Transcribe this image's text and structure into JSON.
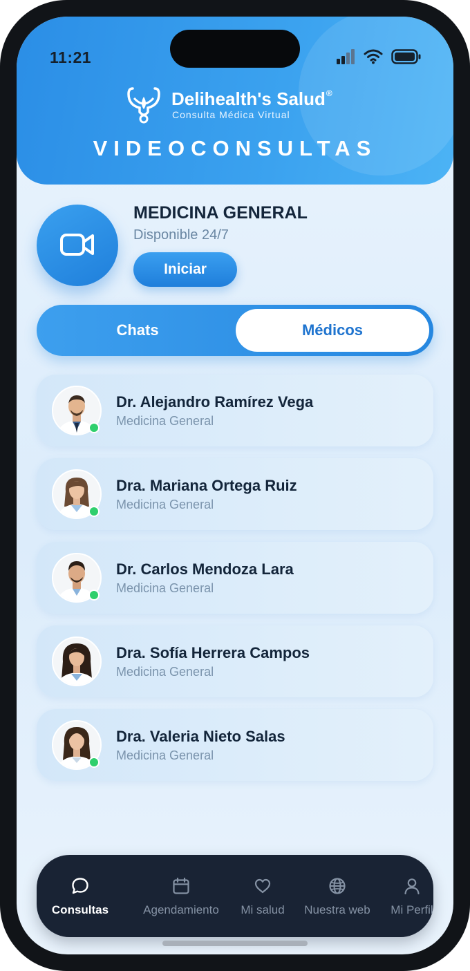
{
  "status_bar": {
    "time": "11:21"
  },
  "brand": {
    "name": "Delihealth's Salud",
    "registered": "®",
    "tagline": "Consulta Médica Virtual"
  },
  "header": {
    "title": "VIDEOCONSULTAS"
  },
  "service": {
    "title": "MEDICINA GENERAL",
    "availability": "Disponible 24/7",
    "start_label": "Iniciar",
    "icon": "video-camera-icon"
  },
  "tabs": [
    {
      "label": "Chats",
      "active": false
    },
    {
      "label": "Médicos",
      "active": true
    }
  ],
  "doctors": [
    {
      "name": "Dr. Alejandro Ramírez Vega",
      "specialty": "Medicina General",
      "online": true
    },
    {
      "name": "Dra. Mariana Ortega Ruiz",
      "specialty": "Medicina General",
      "online": true
    },
    {
      "name": "Dr. Carlos Mendoza Lara",
      "specialty": "Medicina General",
      "online": true
    },
    {
      "name": "Dra. Sofía Herrera Campos",
      "specialty": "Medicina General",
      "online": false
    },
    {
      "name": "Dra. Valeria Nieto Salas",
      "specialty": "Medicina General",
      "online": true
    }
  ],
  "bottom_nav": [
    {
      "label": "Consultas",
      "icon": "chat-bubble-icon",
      "active": true
    },
    {
      "label": "Agendamiento",
      "icon": "calendar-icon",
      "active": false
    },
    {
      "label": "Mi salud",
      "icon": "heart-icon",
      "active": false
    },
    {
      "label": "Nuestra web",
      "icon": "globe-icon",
      "active": false
    },
    {
      "label": "Mi Perfil",
      "icon": "user-icon",
      "active": false
    }
  ],
  "colors": {
    "primary": "#2b8ee6",
    "primary_dark": "#1f7edb",
    "nav_bg": "#192334",
    "online": "#2fcf6d",
    "title_text": "#13253a",
    "muted_text": "#7a93ac"
  }
}
